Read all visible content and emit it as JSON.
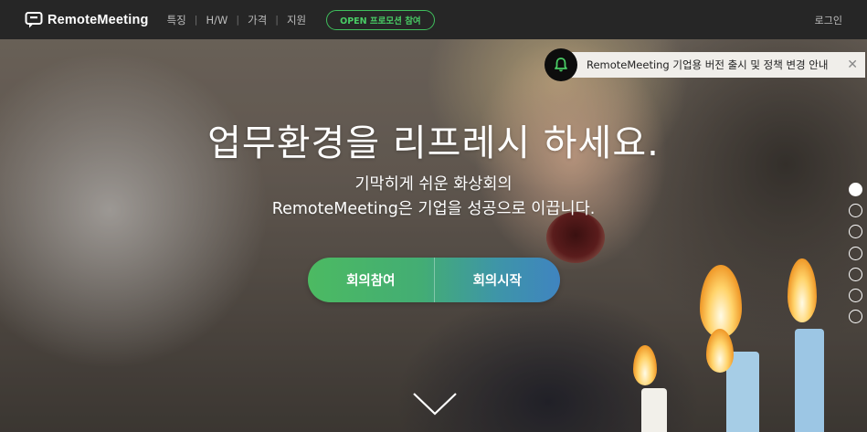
{
  "header": {
    "logo_text": "RemoteMeeting",
    "nav": [
      {
        "label": "특징"
      },
      {
        "label": "H/W"
      },
      {
        "label": "가격"
      },
      {
        "label": "지원"
      }
    ],
    "separator": "|",
    "promo_label": "OPEN 프로모션 참여",
    "login_label": "로그인"
  },
  "notice": {
    "text": "RemoteMeeting 기업용 버전 출시 및 정책 변경 안내",
    "close": "✕"
  },
  "hero": {
    "headline": "업무환경을 리프레시 하세요.",
    "subline1": "기막히게 쉬운 화상회의",
    "subline2": "RemoteMeeting은 기업을 성공으로 이끕니다.",
    "join_label": "회의참여",
    "start_label": "회의시작"
  },
  "pager": {
    "count": 7,
    "active": 0
  },
  "colors": {
    "topbar_bg": "#262626",
    "brand_green": "#49cc65",
    "cta_gradient_start": "#4cba62",
    "cta_gradient_end": "#3f84c0"
  },
  "icons": {
    "logo": "chat-bubble-icon",
    "notice": "bell-icon",
    "scroll": "chevron-down-icon"
  }
}
